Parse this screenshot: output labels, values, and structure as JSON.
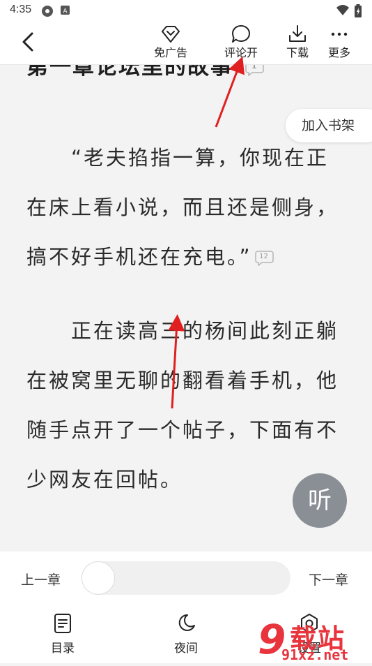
{
  "status_bar": {
    "time": "4:35",
    "icons": [
      "settings-icon",
      "app-icon",
      "wifi-icon",
      "battery-icon"
    ]
  },
  "toolbar": {
    "back_icon": "chevron-left-icon",
    "items": [
      {
        "label": "免广告",
        "icon": "no-ads-icon"
      },
      {
        "label": "评论开",
        "icon": "comment-icon"
      },
      {
        "label": "下载",
        "icon": "download-icon"
      },
      {
        "label": "更多",
        "icon": "more-icon"
      }
    ]
  },
  "reader": {
    "chapter_title": "第一章论坛里的故事",
    "title_comment_count": "1",
    "paragraphs": [
      {
        "text": "“老夫掐指一算，你现在正在床上看小说，而且还是侧身，搞不好手机还在充电。”",
        "comment_count": "12"
      },
      {
        "text": "正在读高三的杨间此刻正躺在被窝里无聊的翻看着手机，他随手点开了一个帖子，下面有不少网友在回帖。",
        "comment_count": ""
      }
    ],
    "add_to_shelf": "加入书架",
    "listen_label": "听"
  },
  "chapter_nav": {
    "prev_label": "上一章",
    "next_label": "下一章",
    "progress": 0
  },
  "bottom_nav": [
    {
      "label": "目录",
      "icon": "catalog-icon"
    },
    {
      "label": "夜间",
      "icon": "moon-icon"
    },
    {
      "label": "设置",
      "icon": "settings-icon"
    }
  ],
  "watermark": {
    "text": "载站",
    "url_text": "91xz.net"
  },
  "colors": {
    "page_background": "#f3f3f3",
    "annotation_arrow": "#e02020",
    "listen_button": "#8a8f96",
    "watermark_red": "#e8343c"
  }
}
